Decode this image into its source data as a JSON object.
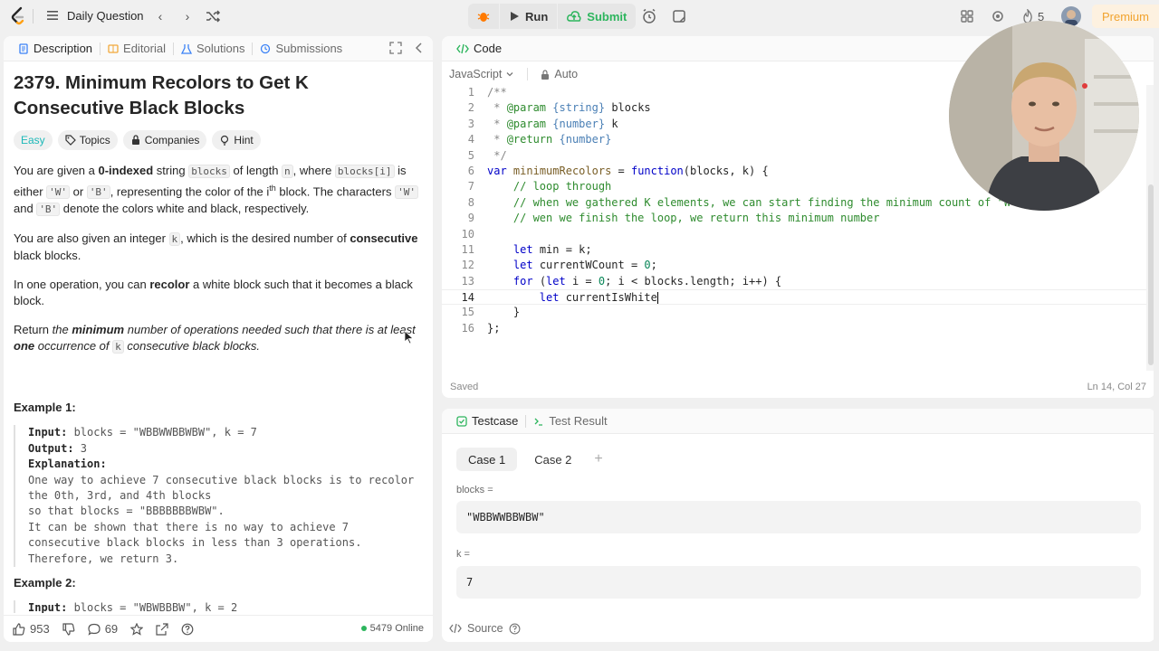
{
  "nav": {
    "title": "Daily Question",
    "run_label": "Run",
    "submit_label": "Submit",
    "streak_count": "5",
    "premium_label": "Premium"
  },
  "left_tabs": [
    "Description",
    "Editorial",
    "Solutions",
    "Submissions"
  ],
  "problem": {
    "title": "2379. Minimum Recolors to Get K Consecutive Black Blocks",
    "difficulty": "Easy",
    "tag_topics": "Topics",
    "tag_companies": "Companies",
    "tag_hint": "Hint",
    "p1_a": "You are given a ",
    "p1_b": "0-indexed",
    "p1_c": " string ",
    "p1_code1": "blocks",
    "p1_d": " of length ",
    "p1_code2": "n",
    "p1_e": ", where ",
    "p1_code3": "blocks[i]",
    "p1_f": " is either ",
    "p1_code4": "'W'",
    "p1_g": " or ",
    "p1_code5": "'B'",
    "p1_h": ", representing the color of the ",
    "p1_i": "i",
    "p1_sup": "th",
    "p1_j": " block. The characters ",
    "p1_code6": "'W'",
    "p1_k": " and ",
    "p1_code7": "'B'",
    "p1_l": " denote the colors white and black, respectively.",
    "p2_a": "You are also given an integer ",
    "p2_code": "k",
    "p2_b": ", which is the desired number of ",
    "p2_c": "consecutive",
    "p2_d": " black blocks.",
    "p3_a": "In one operation, you can ",
    "p3_b": "recolor",
    "p3_c": " a white block such that it becomes a black block.",
    "p4_a": "Return ",
    "p4_b": "the ",
    "p4_c": "minimum",
    "p4_d": " number of operations needed such that there is at least ",
    "p4_e": "one",
    "p4_f": " occurrence of ",
    "p4_code": "k",
    "p4_g": " consecutive black blocks.",
    "ex1_head": "Example 1:",
    "ex1_input_label": "Input:",
    "ex1_input": " blocks = \"WBBWWBBWBW\", k = 7",
    "ex1_output_label": "Output:",
    "ex1_output": " 3",
    "ex1_expl_label": "Explanation:",
    "ex1_l1": "One way to achieve 7 consecutive black blocks is to recolor",
    "ex1_l2": "the 0th, 3rd, and 4th blocks",
    "ex1_l3": "so that blocks = \"BBBBBBBWBW\".",
    "ex1_l4": "It can be shown that there is no way to achieve 7",
    "ex1_l5": "consecutive black blocks in less than 3 operations.",
    "ex1_l6": "Therefore, we return 3.",
    "ex2_head": "Example 2:",
    "ex2_input_label": "Input:",
    "ex2_input": " blocks = \"WBWBBBW\", k = 2"
  },
  "left_footer": {
    "likes": "953",
    "comments": "69",
    "online": "5479 Online"
  },
  "code_panel": {
    "title": "Code",
    "language": "JavaScript",
    "mode": "Auto",
    "saved": "Saved",
    "cursor_pos": "Ln 14, Col 27",
    "line_numbers": [
      "1",
      "2",
      "3",
      "4",
      "5",
      "6",
      "7",
      "8",
      "9",
      "10",
      "11",
      "12",
      "13",
      "14",
      "15",
      "16"
    ]
  },
  "test_panel": {
    "tab_testcase": "Testcase",
    "tab_result": "Test Result",
    "case1": "Case 1",
    "case2": "Case 2",
    "add": "+",
    "param1_label": "blocks =",
    "param1_value": "\"WBBWWBBWBW\"",
    "param2_label": "k =",
    "param2_value": "7",
    "source": "Source"
  },
  "colors": {
    "accent_green": "#2db55d",
    "easy": "#1cb8b8",
    "premium": "#f1a32e",
    "debug": "#ff7a00"
  }
}
